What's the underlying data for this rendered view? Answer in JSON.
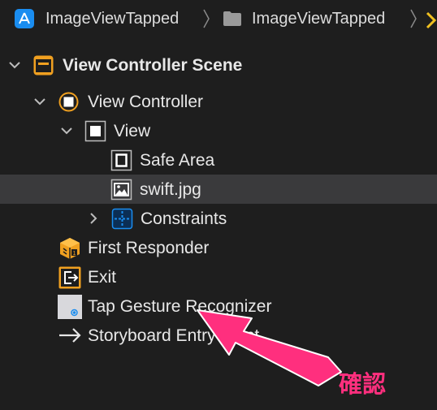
{
  "jump_bar": {
    "project_name": "ImageViewTapped",
    "folder_name": "ImageViewTapped",
    "icons": [
      "xcode-app-icon",
      "folder-icon",
      "chevron-right-icon"
    ]
  },
  "outline": {
    "scene": {
      "label": "View Controller Scene",
      "icon": "scene-icon",
      "expanded": true
    },
    "view_controller": {
      "label": "View Controller",
      "icon": "view-controller-icon",
      "expanded": true
    },
    "view": {
      "label": "View",
      "icon": "view-icon",
      "expanded": true
    },
    "safe_area": {
      "label": "Safe Area",
      "icon": "safe-area-icon"
    },
    "image_view": {
      "label": "swift.jpg",
      "icon": "image-icon",
      "selected": true
    },
    "constraints": {
      "label": "Constraints",
      "icon": "constraints-icon",
      "expanded": false
    },
    "first_responder": {
      "label": "First Responder",
      "icon": "first-responder-icon"
    },
    "exit": {
      "label": "Exit",
      "icon": "exit-icon"
    },
    "tap_gesture": {
      "label": "Tap Gesture Recognizer",
      "icon": "gesture-icon"
    },
    "entry_point": {
      "label": "Storyboard Entry Point",
      "icon": "arrow-right-icon"
    }
  },
  "annotation": {
    "text": "確認",
    "color": "#ff2f7e"
  },
  "colors": {
    "accent_orange": "#f0a020",
    "constraints_blue": "#1a8df0",
    "selection": "#3a3a3c",
    "background": "#1e1e1e"
  }
}
